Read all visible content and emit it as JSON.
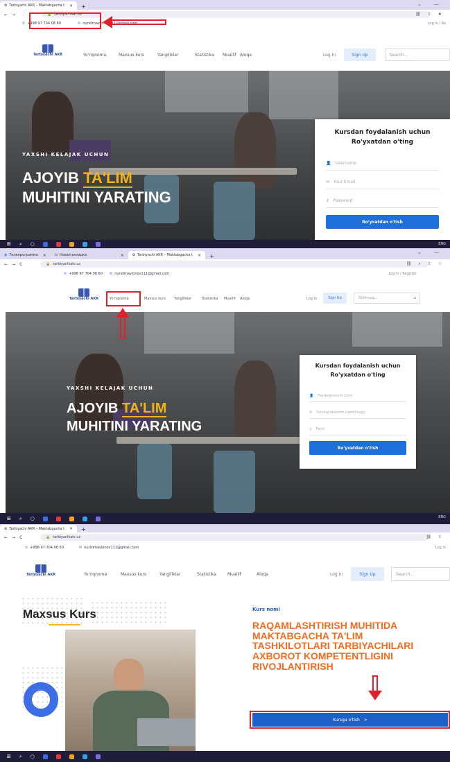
{
  "panel1": {
    "tabs": [
      {
        "label": "Tarbiyachi AKR – Maktabgacha t",
        "active": true
      }
    ],
    "url": "tarbiyachiakr.uz",
    "phone": "+998 97 704 08 60",
    "email": "nurslimavlonov111@gmail.com",
    "login_register": "Log in  /  Re",
    "logo_text": "Tarbiyachi AKR",
    "nav": [
      "Yo'riqnoma",
      "Maxsus kurs",
      "Yangiliklar",
      "Statistika",
      "Muallif",
      "Aloqa"
    ],
    "login": "Log In",
    "signup": "Sign Up",
    "search_placeholder": "Search...",
    "hero": {
      "eyebrow": "YAXSHI KELAJAK UCHUN",
      "line1_a": "AJOYIB ",
      "line1_b": "TA'LIM",
      "line2": "MUHITINI YARATING"
    },
    "form": {
      "title1": "Kursdan foydalanish uchun",
      "title2": "Ro'yxatdan o'ting",
      "username": "Username",
      "email": "Your Email",
      "password": "Password",
      "button": "Ro'yxatdan o'tish"
    }
  },
  "panel2": {
    "tabs": [
      {
        "label": "Телепрограмма",
        "active": false
      },
      {
        "label": "Новая вкладка",
        "active": false
      },
      {
        "label": "Tarbiyachi AKR – Maktabgacha t",
        "active": true
      }
    ],
    "url": "tarbiyachiakr.uz",
    "phone": "+998 97 704 08 60",
    "email": "nurslimavlonov111@gmail.com",
    "login_register": "Log in  /  Register",
    "logo_text": "Tarbiyachi AKR",
    "nav": [
      "Yo'riqnoma",
      "Maxsus kurs",
      "Yangiliklar",
      "Statistika",
      "Muallif",
      "Aloqa"
    ],
    "login": "Log in",
    "signup": "Sign Up",
    "search_placeholder": "Qidirmoq...",
    "hero": {
      "eyebrow": "YAXSHI KELAJAK UCHUN",
      "line1_a": "AJOYIB ",
      "line1_b": "TA'LIM",
      "line2": "MUHITINI YARATING"
    },
    "form": {
      "title1": "Kursdan foydalanish uchun",
      "title2": "Ro'yxatdan o'ting",
      "username": "Foydalanuvchi nomi",
      "email": "Sizning elektron manzilingiz",
      "password": "Parol",
      "button": "Ro'yxatdan o'tish"
    }
  },
  "panel3": {
    "tabs": [
      {
        "label": "Tarbiyachi AKR – Maktabgacha t",
        "active": true
      }
    ],
    "url": "tarbiyachiakr.uz",
    "phone": "+998 97 704 08 60",
    "email": "nurslimavlonov111@gmail.com",
    "login_register": "Log in",
    "logo_text": "Tarbiyachi AKR",
    "nav": [
      "Yo'riqnoma",
      "Maxsus kurs",
      "Yangiliklar",
      "Statistika",
      "Muallif",
      "Aloqa"
    ],
    "login": "Log In",
    "signup": "Sign Up",
    "search_placeholder": "Search...",
    "section_title": "Maxsus Kurs",
    "kurs_nomi_label": "Kurs nomi",
    "course_title_lines": [
      "RAQAMLASHTIRISH MUHITIDA",
      "MAKTABGACHA TA'LIM",
      "TASHKILOTLARI TARBIYACHILARI",
      "AXBOROT KOMPETENTLIGINI",
      "RIVOJLANTIRISH"
    ],
    "course_button": "Kursga o'tish",
    "course_button_arrow": ">"
  },
  "tray": {
    "lang": "ENG"
  },
  "colors": {
    "accent": "#1e6fd9",
    "highlight": "#f5b31a",
    "annotation": "#e0202a",
    "course_title": "#f26b21"
  }
}
